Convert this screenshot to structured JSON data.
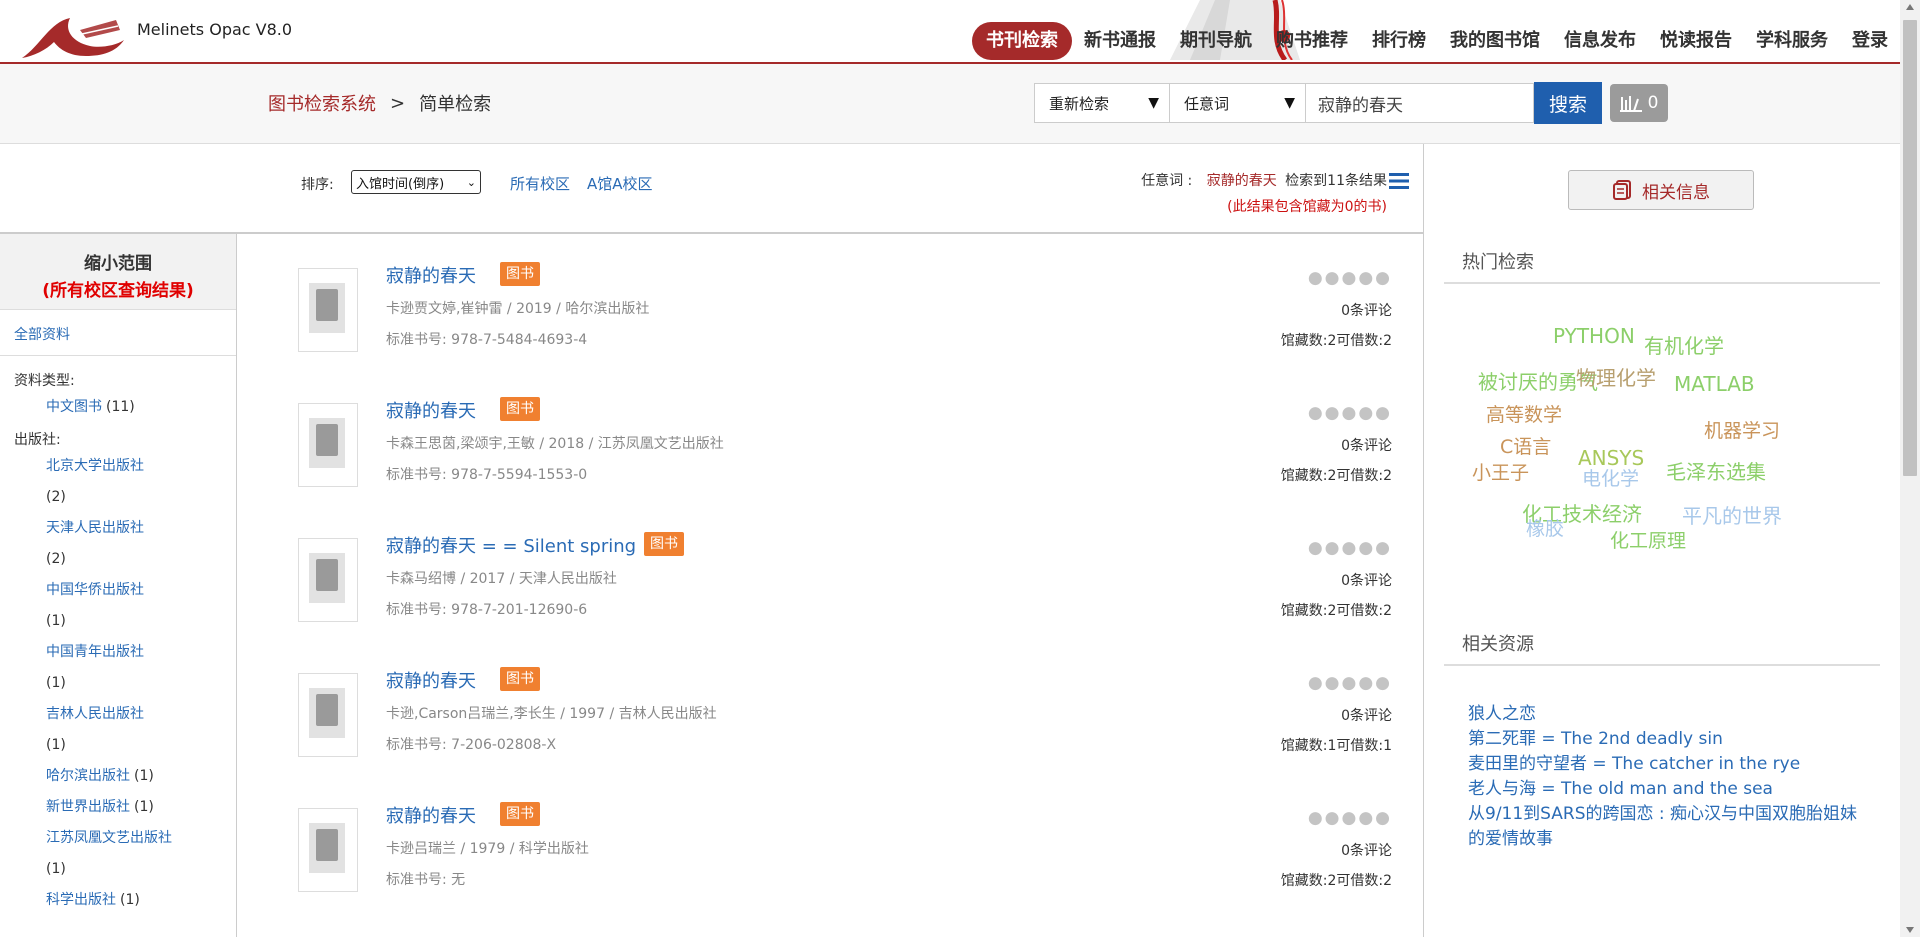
{
  "app": {
    "title": "Melinets Opac V8.0"
  },
  "nav": {
    "items": [
      "书刊检索",
      "新书通报",
      "期刊导航",
      "购书推荐",
      "排行榜",
      "我的图书馆",
      "信息发布",
      "悦读报告",
      "学科服务",
      "登录"
    ],
    "active": "书刊检索"
  },
  "breadcrumb": {
    "root": "图书检索系统",
    "separator": ">",
    "current": "简单检索"
  },
  "search": {
    "mode_selected": "重新检索",
    "field_selected": "任意词",
    "query": "寂静的春天",
    "button_label": "搜索",
    "shelf_count": "0"
  },
  "toolbar": {
    "sort_label": "排序:",
    "sort_selected": "入馆时间(倒序)",
    "campus_all": "所有校区",
    "campus_a": "A馆A校区",
    "query_label": "任意词 :",
    "query_term": "寂静的春天",
    "result_count": "检索到11条结果",
    "result_note": "(此结果包含馆藏为0的书)"
  },
  "facets": {
    "title": "缩小范围",
    "subtitle": "(所有校区查询结果)",
    "all_label": "全部资料",
    "type_label": "资料类型:",
    "types": [
      {
        "name": "中文图书",
        "count": "(11)"
      }
    ],
    "publisher_label": "出版社:",
    "publishers": [
      {
        "name": "北京大学出版社",
        "count": "(2)"
      },
      {
        "name": "天津人民出版社",
        "count": "(2)"
      },
      {
        "name": "中国华侨出版社",
        "count": "(1)"
      },
      {
        "name": "中国青年出版社",
        "count": "(1)"
      },
      {
        "name": "吉林人民出版社",
        "count": "(1)"
      },
      {
        "name": "哈尔滨出版社",
        "count": "(1)"
      },
      {
        "name": "新世界出版社",
        "count": "(1)"
      },
      {
        "name": "江苏凤凰文艺出版社",
        "count": "(1)"
      },
      {
        "name": "科学出版社",
        "count": "(1)"
      }
    ]
  },
  "results": [
    {
      "title": "寂静的春天",
      "badge": "图书",
      "meta": "卡逊贾文婷,崔钟雷 / 2019 / 哈尔滨出版社",
      "isbn": "标准书号:  978-7-5484-4693-4",
      "reviews": "0条评论",
      "holdings": "馆藏数:2可借数:2"
    },
    {
      "title": "寂静的春天",
      "badge": "图书",
      "meta": "卡森王思茵,梁颂宇,王敏 / 2018 / 江苏凤凰文艺出版社",
      "isbn": "标准书号:  978-7-5594-1553-0",
      "reviews": "0条评论",
      "holdings": "馆藏数:2可借数:2"
    },
    {
      "title": "寂静的春天 = = Silent spring",
      "badge": "图书",
      "meta": "卡森马绍博 / 2017 / 天津人民出版社",
      "isbn": "标准书号:  978-7-201-12690-6",
      "reviews": "0条评论",
      "holdings": "馆藏数:2可借数:2"
    },
    {
      "title": "寂静的春天",
      "badge": "图书",
      "meta": "卡逊,Carson吕瑞兰,李长生 / 1997 / 吉林人民出版社",
      "isbn": "标准书号:  7-206-02808-X",
      "reviews": "0条评论",
      "holdings": "馆藏数:1可借数:1"
    },
    {
      "title": "寂静的春天",
      "badge": "图书",
      "meta": "卡逊吕瑞兰 / 1979 / 科学出版社",
      "isbn": "标准书号:  无",
      "reviews": "0条评论",
      "holdings": "馆藏数:2可借数:2"
    }
  ],
  "sidebar": {
    "related_info_label": "相关信息",
    "hot_title": "热门检索",
    "hot_tags": [
      {
        "text": "PYTHON",
        "color": "#8ccf6a"
      },
      {
        "text": "有机化学",
        "color": "#8ccf6a"
      },
      {
        "text": "被讨厌的勇气",
        "color": "#8ccf6a"
      },
      {
        "text": "物理化学",
        "color": "#b8a070"
      },
      {
        "text": "MATLAB",
        "color": "#8ccf6a"
      },
      {
        "text": "高等数学",
        "color": "#c9945a"
      },
      {
        "text": "机器学习",
        "color": "#c9945a"
      },
      {
        "text": "C语言",
        "color": "#c9945a"
      },
      {
        "text": "ANSYS",
        "color": "#a8c85a"
      },
      {
        "text": "小王子",
        "color": "#c9945a"
      },
      {
        "text": "电化学",
        "color": "#a8c8ea"
      },
      {
        "text": "毛泽东选集",
        "color": "#8ccf6a"
      },
      {
        "text": "化工技术经济",
        "color": "#8ccf6a"
      },
      {
        "text": "平凡的世界",
        "color": "#a8c8ea"
      },
      {
        "text": "橡胶",
        "color": "#a8c8ea"
      },
      {
        "text": "化工原理",
        "color": "#8ccf6a"
      }
    ],
    "resources_title": "相关资源",
    "resources": [
      "狼人之恋",
      "第二死罪 = The 2nd deadly sin",
      "麦田里的守望者 = The catcher in the rye",
      "老人与海 = The old man and the sea",
      "从9/11到SARS的跨国恋 : 痴心汉与中国双胞胎姐妹的爱情故事"
    ]
  },
  "colors": {
    "brand": "#a52a2a",
    "link": "#2a6bb5",
    "search_button": "#1f5fae",
    "badge": "#f08030"
  }
}
